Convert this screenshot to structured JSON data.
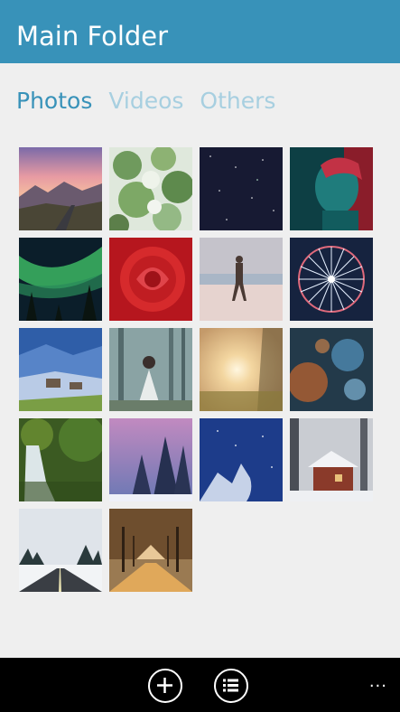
{
  "header": {
    "title": "Main Folder"
  },
  "pivot": {
    "tabs": [
      "Photos",
      "Videos",
      "Others"
    ],
    "active": "Photos"
  },
  "colors": {
    "accent": "#3892b9",
    "inactive_tab": "#a7cfe0",
    "background": "#efefef",
    "appbar": "#000000"
  },
  "photos": [
    {
      "name": "mountain-sunset",
      "subject": "pink sunset over mountains and road"
    },
    {
      "name": "green-branches",
      "subject": "green leafy branches"
    },
    {
      "name": "starry-night",
      "subject": "dark starry sky"
    },
    {
      "name": "neon-portrait",
      "subject": "man lit by red and teal light"
    },
    {
      "name": "northern-lights",
      "subject": "green aurora over pine trees"
    },
    {
      "name": "red-rose",
      "subject": "close-up red rose"
    },
    {
      "name": "beach-walker",
      "subject": "man walking on beach"
    },
    {
      "name": "ferris-wheel",
      "subject": "ferris wheel at dusk"
    },
    {
      "name": "snowy-village",
      "subject": "blue snowy village landscape"
    },
    {
      "name": "forest-girl",
      "subject": "girl in white dress in misty forest"
    },
    {
      "name": "sun-flare",
      "subject": "sunlight through trees"
    },
    {
      "name": "bokeh-lights",
      "subject": "blue and orange bokeh"
    },
    {
      "name": "waterfall",
      "subject": "mossy forest waterfall"
    },
    {
      "name": "snowy-pines",
      "subject": "snowy pine trees under purple sky"
    },
    {
      "name": "snowy-branches",
      "subject": "snow branches against blue night"
    },
    {
      "name": "snow-cabin",
      "subject": "red cabin in snowy forest"
    },
    {
      "name": "winter-road",
      "subject": "road through snowy pines"
    },
    {
      "name": "autumn-avenue",
      "subject": "autumn tree-lined path"
    }
  ],
  "appbar": {
    "add_icon": "add-icon",
    "list_icon": "list-icon",
    "more_label": "..."
  }
}
